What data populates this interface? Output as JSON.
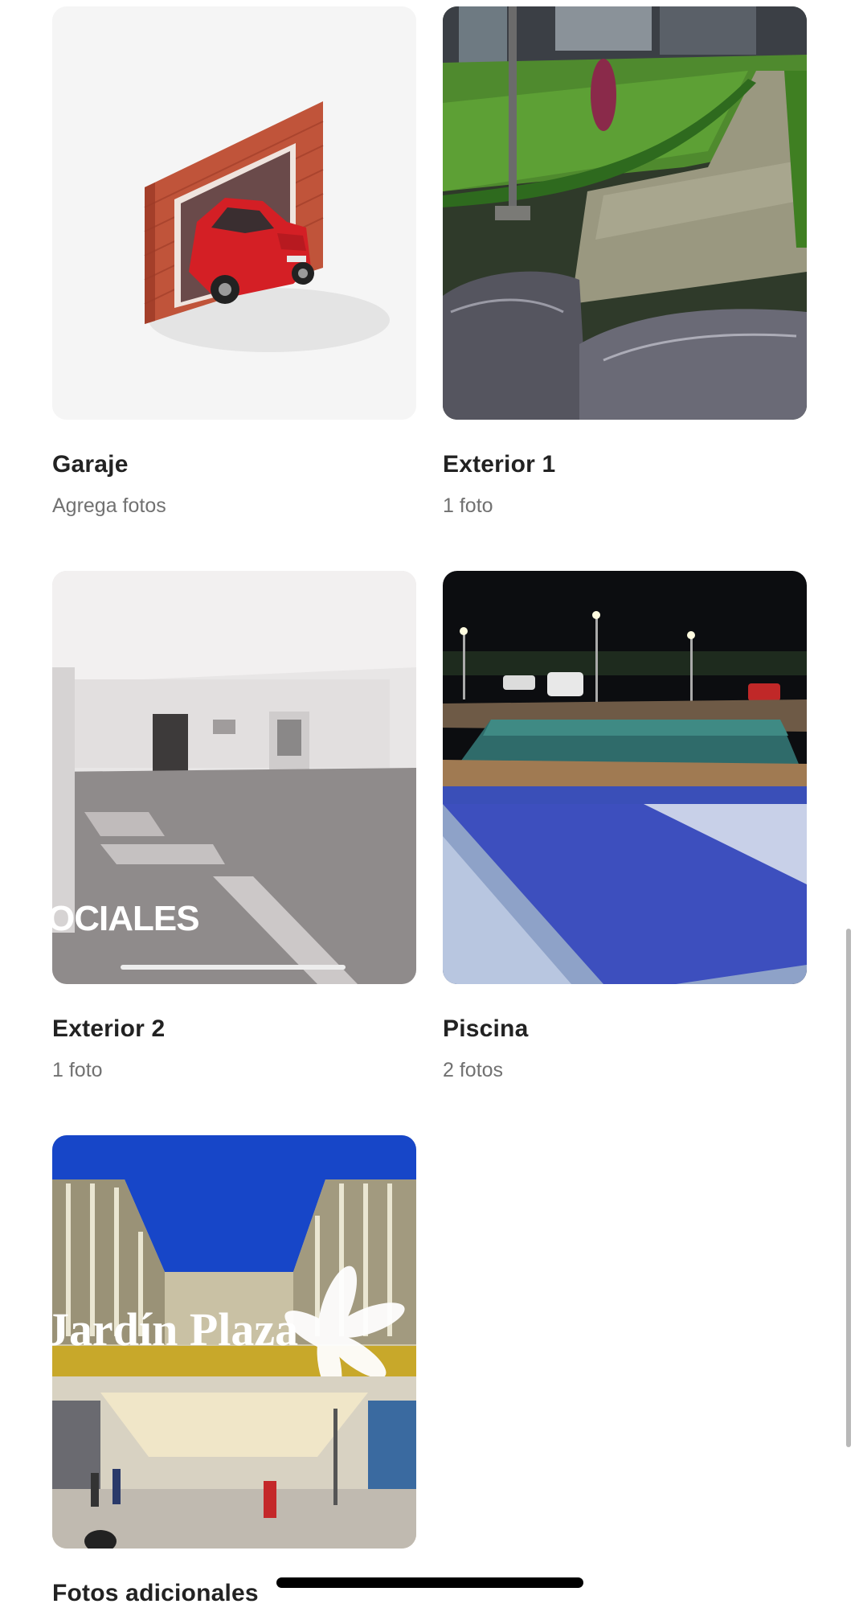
{
  "cards": [
    {
      "title": "Garaje",
      "subtitle": "Agrega fotos",
      "image": "garage-illustration"
    },
    {
      "title": "Exterior 1",
      "subtitle": "1 foto",
      "image": "garden-walkway-photo"
    },
    {
      "title": "Exterior 2",
      "subtitle": "1 foto",
      "image": "social-hall-photo",
      "overlay_text": "OCIALES"
    },
    {
      "title": "Piscina",
      "subtitle": "2 fotos",
      "image": "pool-night-photo"
    },
    {
      "title": "Fotos adicionales",
      "subtitle": "",
      "image": "mall-photo",
      "overlay_text": "Jardín Plaza"
    }
  ],
  "colors": {
    "text": "#222222",
    "muted": "#717171",
    "background": "#ffffff"
  }
}
